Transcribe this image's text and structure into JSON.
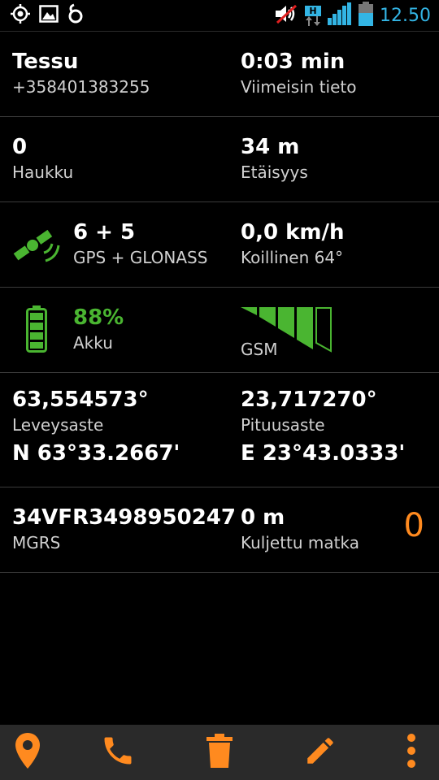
{
  "status_bar": {
    "time": "12.50",
    "network_badge": "H",
    "icons": [
      "gps-icon",
      "image-icon",
      "app-icon",
      "mute-icon",
      "network-icon",
      "signal-icon",
      "battery-icon"
    ]
  },
  "rows": {
    "contact": {
      "name": "Tessu",
      "phone": "+358401383255",
      "age_value": "0:03 min",
      "age_label": "Viimeisin tieto"
    },
    "bark": {
      "value": "0",
      "label": "Haukku",
      "distance_value": "34 m",
      "distance_label": "Etäisyys"
    },
    "satellites": {
      "value": "6 + 5",
      "label": "GPS + GLONASS",
      "speed_value": "0,0 km/h",
      "speed_label": "Koillinen 64°"
    },
    "battery": {
      "value": "88%",
      "label": "Akku",
      "gsm_label": "GSM",
      "battery_level": 0.88,
      "gsm_bars_filled": 4,
      "gsm_bars_total": 5
    },
    "coordinates": {
      "lat_value": "63,554573°",
      "lat_label": "Leveysaste",
      "lat_dm": "N 63°33.2667'",
      "lon_value": "23,717270°",
      "lon_label": "Pituusaste",
      "lon_dm": "E 23°43.0333'"
    },
    "mgrs": {
      "value": "34VFR3498950247",
      "label": "MGRS",
      "traveled_value": "0 m",
      "traveled_label": "Kuljettu matka",
      "counter": "0"
    }
  },
  "bottom_bar": {
    "buttons": [
      "location-pin-icon",
      "phone-icon",
      "trash-icon",
      "edit-icon",
      "more-icon"
    ]
  },
  "colors": {
    "accent_orange": "#ff8a1f",
    "accent_green": "#4ab531",
    "status_blue": "#33b5e5"
  }
}
